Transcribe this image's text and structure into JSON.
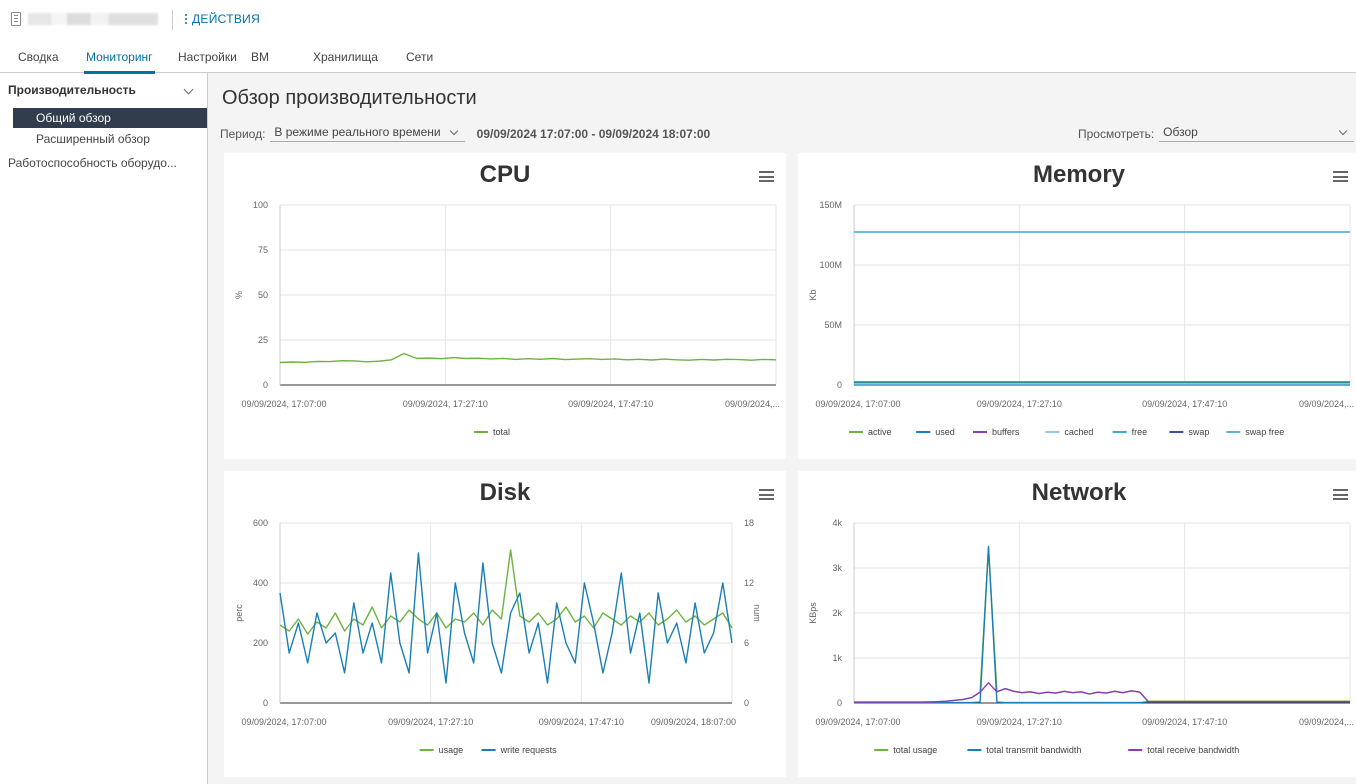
{
  "header": {
    "actions_label": "ДЕЙСТВИЯ"
  },
  "tabs": [
    "Сводка",
    "Мониторинг",
    "Настройки",
    "ВМ",
    "Хранилища",
    "Сети"
  ],
  "sidebar": {
    "group_label": "Производительность",
    "items": [
      "Общий обзор",
      "Расширенный обзор"
    ],
    "hardware_label": "Работоспособность оборудо..."
  },
  "main": {
    "title": "Обзор производительности",
    "period_label": "Период:",
    "period_value": "В режиме реального времени",
    "time_range": "09/09/2024 17:07:00 - 09/09/2024 18:07:00",
    "view_label": "Просмотреть:",
    "view_value": "Обзор"
  },
  "colors": {
    "accent": "#0072a3",
    "sidebar_active_bg": "#313d4c",
    "green": "#6cb33f",
    "blue": "#1a7fb5",
    "purple": "#8e3bb3",
    "light_blue": "#8fcae8",
    "cyan": "#3aa8d8",
    "navy": "#3a4fa8"
  },
  "chart_data": [
    {
      "type": "line",
      "title": "CPU",
      "ylabel": "%",
      "ylim": [
        0,
        100
      ],
      "yticks": [
        "0",
        "25",
        "50",
        "75",
        "100"
      ],
      "x_tick_labels": [
        "09/09/2024, 17:07:00",
        "09/09/2024, 17:27:10",
        "09/09/2024, 17:47:10",
        "09/09/2024,..."
      ],
      "series": [
        {
          "name": "total",
          "color": "#6cb33f",
          "values": [
            12.5,
            12.8,
            12.6,
            13.1,
            13.0,
            13.5,
            13.4,
            12.9,
            13.2,
            14.0,
            17.5,
            14.8,
            15.0,
            14.6,
            15.2,
            14.7,
            14.9,
            14.5,
            14.8,
            14.2,
            14.6,
            14.3,
            14.7,
            14.1,
            14.4,
            14.6,
            14.2,
            14.5,
            14.0,
            14.3,
            13.9,
            14.4,
            14.0,
            13.8,
            14.2,
            13.9,
            14.3,
            14.1,
            13.8,
            14.2,
            14.0
          ]
        }
      ],
      "legend": [
        "total"
      ],
      "legend_position": "bottom"
    },
    {
      "type": "line",
      "title": "Memory",
      "ylabel": "Kb",
      "ylim": [
        0,
        150000000
      ],
      "yticks": [
        "0",
        "50M",
        "100M",
        "150M"
      ],
      "x_tick_labels": [
        "09/09/2024, 17:07:00",
        "09/09/2024, 17:27:10",
        "09/09/2024, 17:47:10",
        "09/09/2024,..."
      ],
      "series": [
        {
          "name": "active",
          "color": "#6cb33f",
          "values": [
            1500000,
            1500000
          ]
        },
        {
          "name": "used",
          "color": "#1a7fb5",
          "values": [
            2500000,
            2500000
          ]
        },
        {
          "name": "buffers",
          "color": "#8e3bb3",
          "values": [
            200000,
            200000
          ]
        },
        {
          "name": "cached",
          "color": "#8fcae8",
          "values": [
            1000000,
            1000000
          ]
        },
        {
          "name": "free",
          "color": "#3aa8d8",
          "values": [
            127500000,
            127500000
          ]
        },
        {
          "name": "swap",
          "color": "#3a4fa8",
          "values": [
            0,
            0
          ]
        },
        {
          "name": "swap free",
          "color": "#5ab4d6",
          "values": [
            0,
            0
          ]
        }
      ],
      "legend": [
        "active",
        "used",
        "buffers",
        "cached",
        "free",
        "swap",
        "swap free"
      ],
      "legend_position": "bottom"
    },
    {
      "type": "line",
      "title": "Disk",
      "ylabel": "perc",
      "ylabel_right": "num",
      "ylim": [
        0,
        600
      ],
      "ylim_right": [
        0,
        18
      ],
      "yticks": [
        "0",
        "200",
        "400",
        "600"
      ],
      "yticks_right": [
        "0",
        "6",
        "12",
        "18"
      ],
      "x_tick_labels": [
        "09/09/2024, 17:07:00",
        "09/09/2024, 17:27:10",
        "09/09/2024, 17:47:10",
        "09/09/2024, 18:07:00"
      ],
      "series": [
        {
          "name": "usage",
          "color": "#6cb33f",
          "axis": "left",
          "values": [
            260,
            240,
            280,
            230,
            270,
            250,
            300,
            240,
            280,
            260,
            320,
            250,
            290,
            270,
            310,
            280,
            260,
            300,
            250,
            280,
            270,
            300,
            260,
            310,
            280,
            510,
            290,
            270,
            300,
            260,
            280,
            320,
            270,
            290,
            250,
            300,
            280,
            260,
            290,
            270,
            300,
            260,
            280,
            310,
            270,
            290,
            260,
            280,
            300,
            250
          ]
        },
        {
          "name": "write requests",
          "color": "#1a7fb5",
          "axis": "right",
          "values": [
            11,
            5,
            8,
            4,
            9,
            6,
            7,
            3,
            10,
            5,
            8,
            4,
            13,
            6,
            3,
            15,
            5,
            9,
            2,
            12,
            7,
            4,
            14,
            6,
            3,
            9,
            11,
            5,
            8,
            2,
            10,
            6,
            4,
            12,
            8,
            3,
            7,
            13,
            5,
            9,
            2,
            11,
            6,
            8,
            4,
            10,
            5,
            7,
            12,
            6
          ]
        }
      ],
      "legend": [
        "usage",
        "write requests"
      ],
      "legend_position": "bottom"
    },
    {
      "type": "line",
      "title": "Network",
      "ylabel": "KBps",
      "ylim": [
        0,
        4000
      ],
      "yticks": [
        "0",
        "1k",
        "2k",
        "3k",
        "4k"
      ],
      "x_tick_labels": [
        "09/09/2024, 17:07:00",
        "09/09/2024, 17:27:10",
        "09/09/2024, 17:47:10",
        "09/09/2024,..."
      ],
      "series": [
        {
          "name": "total usage",
          "color": "#6cb33f",
          "values": [
            20,
            20,
            20,
            20,
            20,
            20,
            20,
            20,
            20,
            25,
            30,
            40,
            60,
            80,
            120,
            240,
            3450,
            250,
            320,
            260,
            230,
            250,
            210,
            240,
            220,
            260,
            230,
            250,
            200,
            240,
            220,
            260,
            230,
            270,
            240,
            40,
            40,
            40,
            40,
            40,
            40,
            40,
            40,
            40,
            40,
            40,
            40,
            40,
            40,
            40,
            40,
            40,
            40,
            40,
            40,
            40,
            40,
            40,
            40,
            40
          ]
        },
        {
          "name": "total transmit bandwidth",
          "color": "#1a7fb5",
          "values": [
            10,
            10,
            10,
            10,
            10,
            10,
            10,
            10,
            10,
            10,
            10,
            10,
            10,
            10,
            10,
            20,
            3480,
            20,
            10,
            10,
            10,
            10,
            10,
            10,
            10,
            10,
            10,
            10,
            10,
            10,
            10,
            10,
            10,
            10,
            10,
            30,
            30,
            30,
            30,
            30,
            30,
            30,
            30,
            30,
            30,
            30,
            30,
            30,
            30,
            30,
            30,
            30,
            30,
            30,
            30,
            30,
            30,
            30,
            30,
            30
          ]
        },
        {
          "name": "total receive bandwidth",
          "color": "#8e3bb3",
          "values": [
            20,
            20,
            20,
            20,
            20,
            20,
            20,
            20,
            20,
            25,
            30,
            40,
            60,
            80,
            120,
            240,
            450,
            250,
            320,
            260,
            230,
            250,
            210,
            240,
            220,
            260,
            230,
            250,
            200,
            240,
            220,
            260,
            230,
            270,
            240,
            30,
            30,
            30,
            30,
            30,
            30,
            30,
            30,
            30,
            30,
            30,
            30,
            30,
            30,
            30,
            30,
            30,
            30,
            30,
            30,
            30,
            30,
            30,
            30,
            30
          ]
        }
      ],
      "legend": [
        "total usage",
        "total transmit bandwidth",
        "total receive bandwidth"
      ],
      "legend_position": "bottom"
    }
  ]
}
